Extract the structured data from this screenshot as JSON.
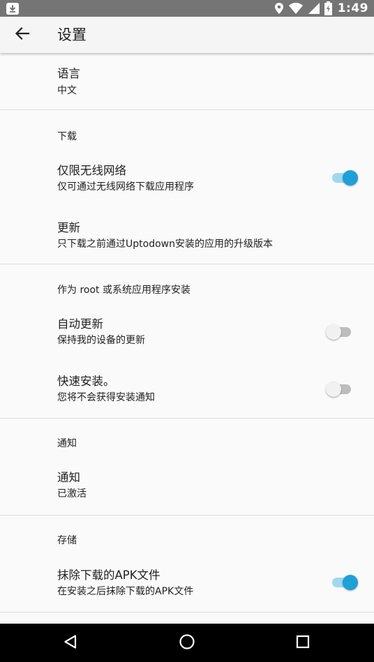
{
  "status_bar": {
    "time": "1:49",
    "icons": [
      "download-app-icon",
      "location-icon",
      "wifi-icon",
      "signal-icon",
      "battery-charging-icon"
    ]
  },
  "app_bar": {
    "title": "设置",
    "back_icon": "arrow-back-icon"
  },
  "settings": {
    "language": {
      "title": "语言",
      "summary": "中文"
    },
    "download_category": "下载",
    "wifi_only": {
      "title": "仅限无线网络",
      "summary": "仅可通过无线网络下载应用程序",
      "enabled": true
    },
    "updates": {
      "title": "更新",
      "summary": "只下载之前通过Uptodown安装的应用的升级版本"
    },
    "root_category": "作为 root 或系统应用程序安装",
    "auto_update": {
      "title": "自动更新",
      "summary": "保持我的设备的更新",
      "enabled": false
    },
    "fast_install": {
      "title": "快速安装。",
      "summary": "您将不会获得安装通知",
      "enabled": false
    },
    "notifications_category": "通知",
    "notifications": {
      "title": "通知",
      "summary": "已激活"
    },
    "storage_category": "存储",
    "delete_apk": {
      "title": "抹除下载的APK文件",
      "summary": "在安装之后抹除下载的APK文件",
      "enabled": true
    }
  },
  "nav_bar": {
    "icons": [
      "back-triangle-icon",
      "home-circle-icon",
      "recents-square-icon"
    ]
  },
  "colors": {
    "accent": "#1ea0d8",
    "accent_track": "#9fd8f0",
    "status_bar": "#757575",
    "app_bar": "#f5f5f5",
    "background": "#fafafa"
  }
}
